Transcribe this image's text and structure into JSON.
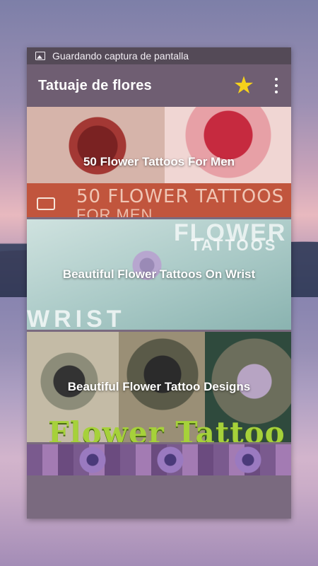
{
  "notification": {
    "text": "Guardando captura de pantalla",
    "icon": "image-icon"
  },
  "toolbar": {
    "title": "Tatuaje de flores",
    "favorite_icon": "star-icon",
    "favorite_color": "#f6d21b",
    "overflow_icon": "more-vertical-icon",
    "background": "#6f5e72"
  },
  "items": [
    {
      "label": "50 Flower Tattoos For Men",
      "image_caption_line1": "50 FLOWER TATTOOS",
      "image_caption_line2": "FOR MEN"
    },
    {
      "label": "Beautiful Flower Tattoos On Wrist",
      "image_caption_top1": "FLOWER",
      "image_caption_top2": "TATTOOS",
      "image_caption_bottom": "WRIST"
    },
    {
      "label": "Beautiful Flower Tattoo Designs",
      "image_caption": "Flower Tattoo"
    }
  ]
}
